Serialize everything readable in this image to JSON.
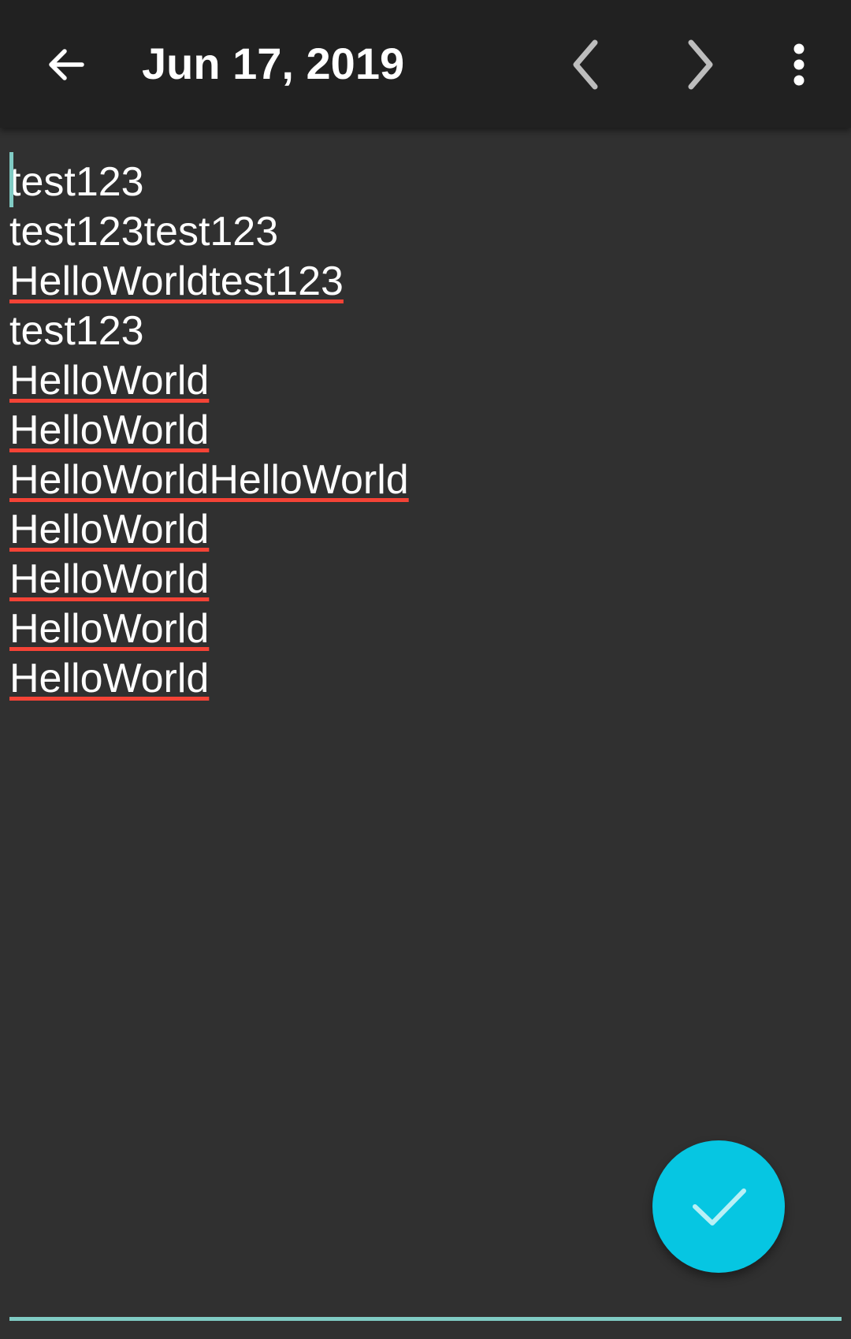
{
  "toolbar": {
    "title": "Jun 17, 2019",
    "back_icon": "arrow-left-icon",
    "prev_icon": "chevron-left-icon",
    "next_icon": "chevron-right-icon",
    "more_icon": "more-vert-icon"
  },
  "note": {
    "lines": [
      "test123",
      "test123test123",
      "HelloWorldtest123",
      "test123",
      "HelloWorld",
      "HelloWorld",
      "HelloWorldHelloWorld",
      "HelloWorld",
      "HelloWorld",
      "HelloWorld",
      "HelloWorld"
    ],
    "misspelled_line_indexes": [
      2,
      4,
      5,
      6,
      7,
      8,
      9,
      10
    ]
  },
  "fab": {
    "icon": "check-icon"
  },
  "colors": {
    "toolbar_bg": "#212121",
    "page_bg": "#303030",
    "accent": "#80cbc4",
    "fab": "#06c6e2",
    "spellcheck_underline": "#f44336"
  }
}
